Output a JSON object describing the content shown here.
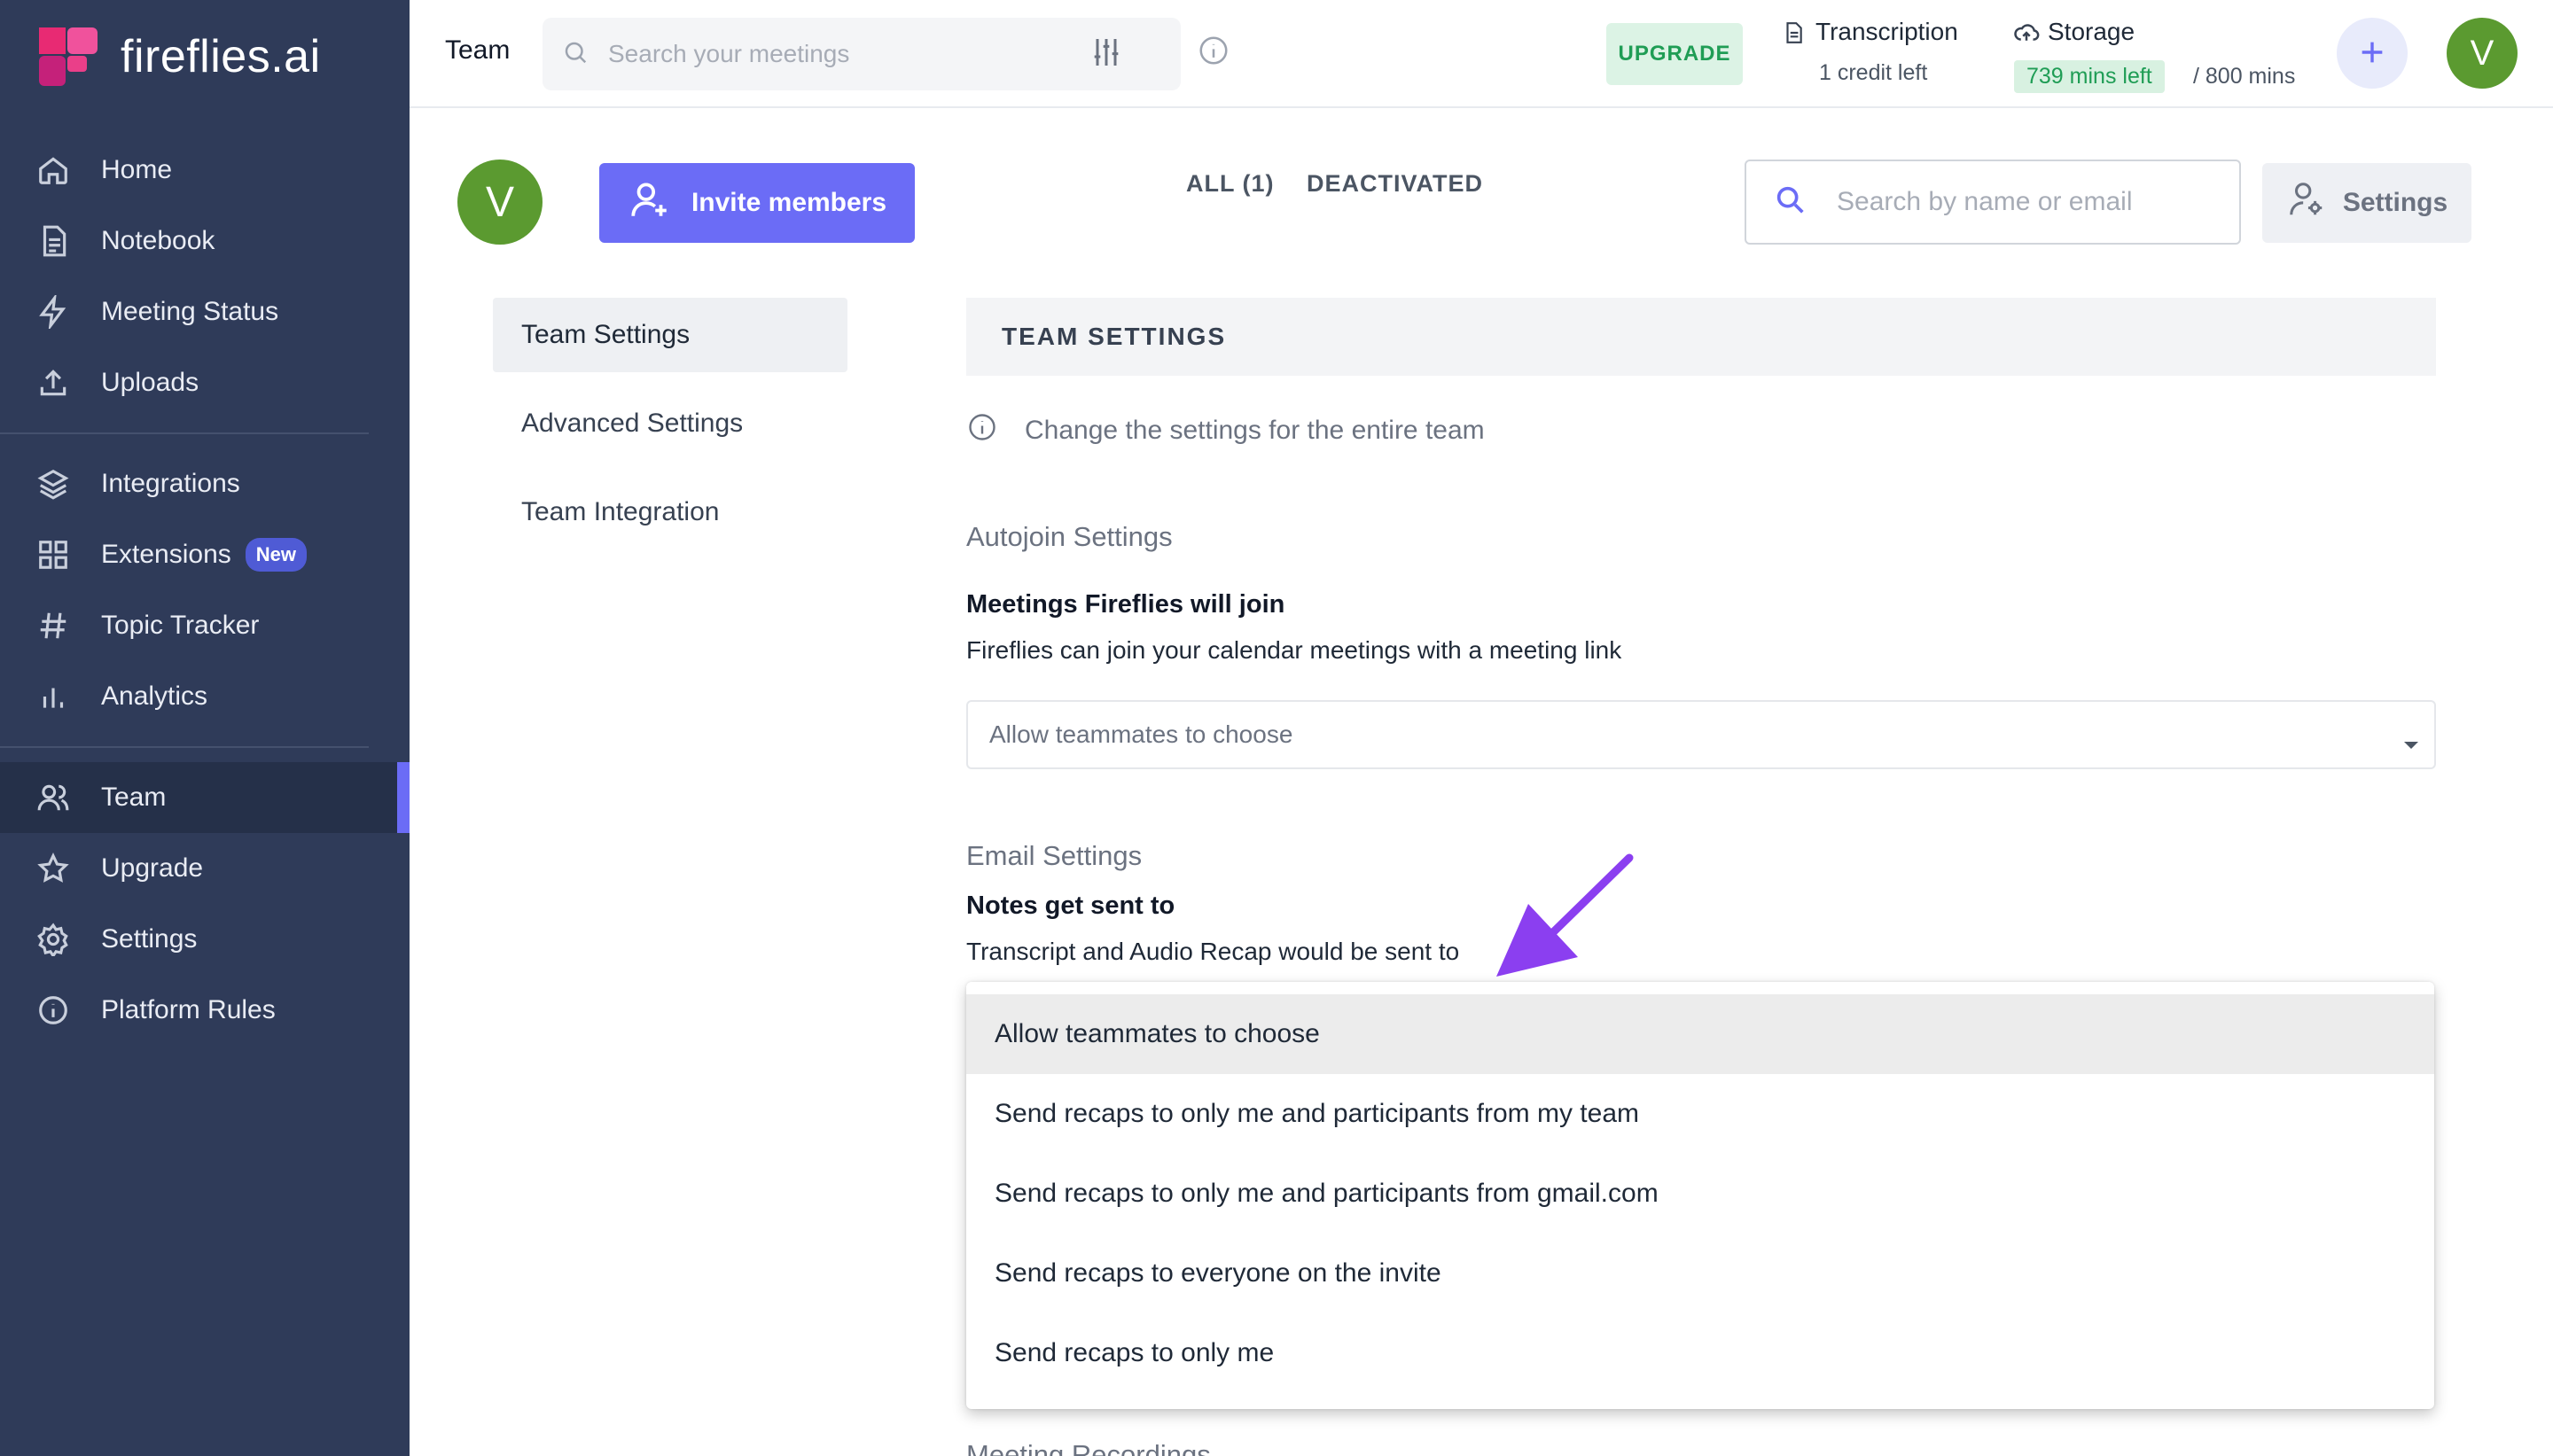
{
  "brand": {
    "name": "fireflies.ai"
  },
  "sidebar": {
    "items": [
      {
        "label": "Home",
        "icon": "home-icon"
      },
      {
        "label": "Notebook",
        "icon": "notebook-icon"
      },
      {
        "label": "Meeting Status",
        "icon": "bolt-icon"
      },
      {
        "label": "Uploads",
        "icon": "upload-icon"
      },
      {
        "label": "Integrations",
        "icon": "layers-icon"
      },
      {
        "label": "Extensions",
        "icon": "grid-icon",
        "badge": "New"
      },
      {
        "label": "Topic Tracker",
        "icon": "hashtag-icon"
      },
      {
        "label": "Analytics",
        "icon": "bar-chart-icon"
      },
      {
        "label": "Team",
        "icon": "team-icon",
        "active": true
      },
      {
        "label": "Upgrade",
        "icon": "star-icon"
      },
      {
        "label": "Settings",
        "icon": "gear-icon"
      },
      {
        "label": "Platform Rules",
        "icon": "info-icon"
      }
    ]
  },
  "header": {
    "title": "Team",
    "search_placeholder": "Search your meetings",
    "upgrade_label": "UPGRADE",
    "transcription": {
      "title": "Transcription",
      "sub": "1 credit left"
    },
    "storage": {
      "title": "Storage",
      "left": "739 mins left",
      "total": "/ 800 mins"
    },
    "avatar_initial": "V"
  },
  "toolbar": {
    "avatar_initial": "V",
    "invite_label": "Invite members",
    "tabs": [
      {
        "label": "ALL (1)"
      },
      {
        "label": "DEACTIVATED"
      }
    ],
    "member_search_placeholder": "Search by name or email",
    "settings_label": "Settings"
  },
  "settings_menu": {
    "items": [
      {
        "label": "Team Settings",
        "active": true
      },
      {
        "label": "Advanced Settings"
      },
      {
        "label": "Team Integration"
      }
    ]
  },
  "panel": {
    "heading": "TEAM SETTINGS",
    "description": "Change the settings for the entire team",
    "autojoin": {
      "section_title": "Autojoin Settings",
      "field_title": "Meetings Fireflies will join",
      "field_desc": "Fireflies can join your calendar meetings with a meeting link",
      "selected": "Allow teammates to choose"
    },
    "email": {
      "section_title": "Email Settings",
      "field_title": "Notes get sent to",
      "field_desc": "Transcript and Audio Recap would be sent to",
      "options": [
        "Allow teammates to choose",
        "Send recaps to only me and participants from my team",
        "Send recaps to only me and participants from gmail.com",
        "Send recaps to everyone on the invite",
        "Send recaps to only me"
      ],
      "selected_index": 0
    },
    "next_section_title": "Meeting Recordings"
  },
  "colors": {
    "sidebar_bg": "#2f3b59",
    "accent": "#6b6cf6",
    "avatar": "#5b9a30",
    "upgrade_green": "#1f9d55",
    "arrow": "#8b3ff0"
  }
}
